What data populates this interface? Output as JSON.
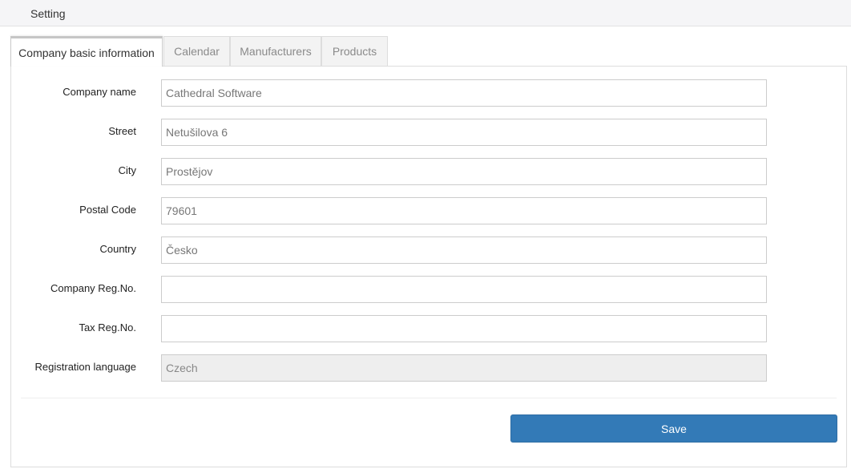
{
  "topbar": {
    "title": "Setting"
  },
  "tabs": [
    {
      "label": "Company basic information",
      "active": true
    },
    {
      "label": "Calendar",
      "active": false
    },
    {
      "label": "Manufacturers",
      "active": false
    },
    {
      "label": "Products",
      "active": false
    }
  ],
  "form": {
    "company_name": {
      "label": "Company name",
      "value": "Cathedral Software"
    },
    "street": {
      "label": "Street",
      "value": "Netušilova 6"
    },
    "city": {
      "label": "City",
      "value": "Prostějov"
    },
    "postal_code": {
      "label": "Postal Code",
      "value": "79601"
    },
    "country": {
      "label": "Country",
      "value": "Česko"
    },
    "company_reg_no": {
      "label": "Company Reg.No.",
      "value": ""
    },
    "tax_reg_no": {
      "label": "Tax Reg.No.",
      "value": ""
    },
    "registration_language": {
      "label": "Registration language",
      "value": "Czech",
      "disabled": true
    }
  },
  "actions": {
    "save_label": "Save"
  },
  "colors": {
    "primary": "#337ab7",
    "disabled_bg": "#eeeeee",
    "border": "#cccccc"
  }
}
